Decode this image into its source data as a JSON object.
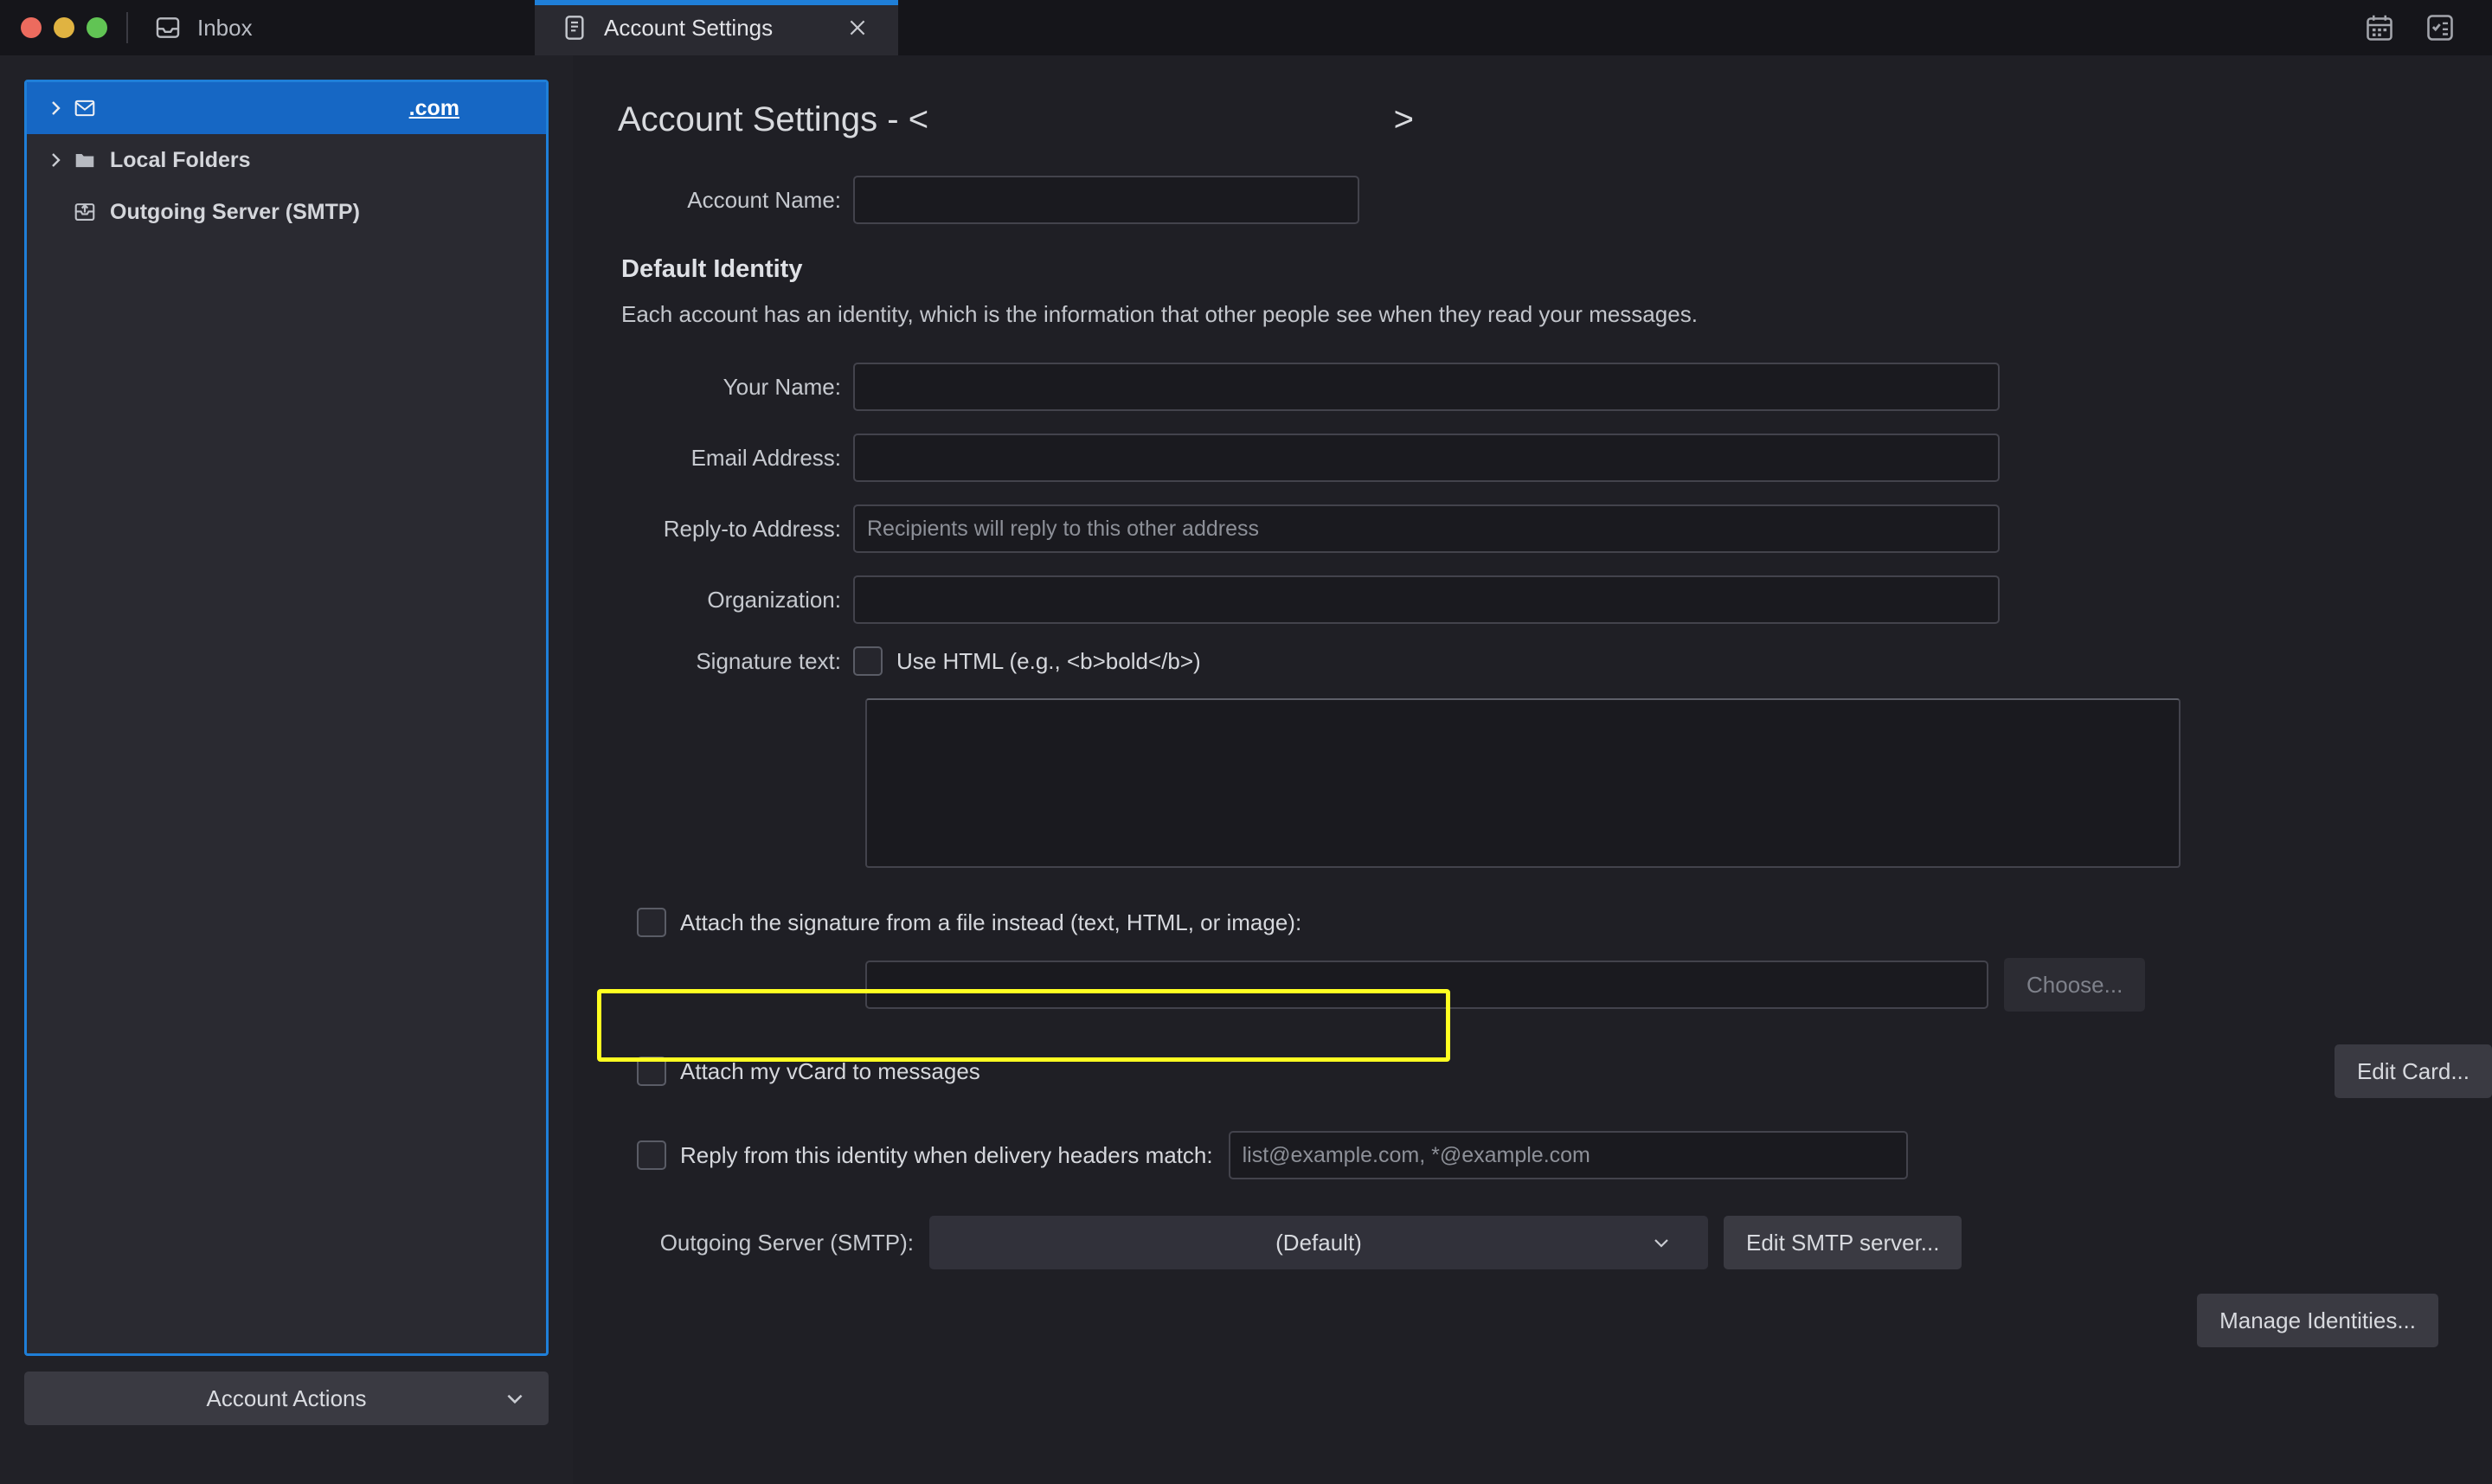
{
  "window": {
    "traffic_lights": [
      "close",
      "minimize",
      "zoom"
    ],
    "colors": {
      "accent_blue": "#1f7fd8",
      "selection_blue": "#1667c4",
      "highlight_yellow": "#ffff21",
      "window_bg": "#1f1f25",
      "sidebar_bg": "#212127"
    }
  },
  "tabs": [
    {
      "label": "Inbox",
      "icon": "inbox-icon",
      "active": false
    },
    {
      "label": "Account Settings",
      "icon": "document-settings-icon",
      "active": true,
      "close_label": "×"
    }
  ],
  "toolbar_icons": [
    {
      "name": "calendar-icon"
    },
    {
      "name": "tasks-icon"
    }
  ],
  "sidebar": {
    "items": [
      {
        "label": ".com",
        "icon": "envelope-icon",
        "selected": true,
        "expandable": true,
        "underlined": true
      },
      {
        "label": "Local Folders",
        "icon": "folder-icon",
        "selected": false,
        "expandable": true
      },
      {
        "label": "Outgoing Server (SMTP)",
        "icon": "outbox-icon",
        "selected": false,
        "expandable": false
      }
    ],
    "account_actions": {
      "label": "Account Actions",
      "caret": "⌄"
    }
  },
  "main": {
    "title_prefix": "Account Settings - <",
    "title_suffix": ">",
    "account_name": {
      "label": "Account Name:",
      "value": "",
      "placeholder": ""
    },
    "identity": {
      "heading": "Default Identity",
      "description": "Each account has an identity, which is the information that other people see when they read your messages.",
      "fields": [
        {
          "label": "Your Name:",
          "value": "",
          "placeholder": ""
        },
        {
          "label": "Email Address:",
          "value": "",
          "placeholder": ""
        },
        {
          "label": "Reply-to Address:",
          "value": "",
          "placeholder": "Recipients will reply to this other address"
        },
        {
          "label": "Organization:",
          "value": "",
          "placeholder": ""
        }
      ],
      "signature": {
        "label": "Signature text:",
        "use_html_label": "Use HTML (e.g., <b>bold</b>)",
        "use_html_checked": false,
        "body": ""
      },
      "attach_signature_file": {
        "label": "Attach the signature from a file instead (text, HTML, or image):",
        "checked": false,
        "highlighted": true,
        "path_value": "",
        "choose_button": "Choose...",
        "choose_disabled": true
      },
      "vcard": {
        "label": "Attach my vCard to messages",
        "checked": false,
        "edit_button": "Edit Card..."
      },
      "delivery_headers": {
        "label": "Reply from this identity when delivery headers match:",
        "checked": false,
        "value": "",
        "placeholder": "list@example.com, *@example.com"
      },
      "smtp": {
        "label": "Outgoing Server (SMTP):",
        "selected_option": "(Default)",
        "caret": "⌄",
        "edit_button": "Edit SMTP server..."
      },
      "manage_identities_button": "Manage Identities..."
    }
  }
}
